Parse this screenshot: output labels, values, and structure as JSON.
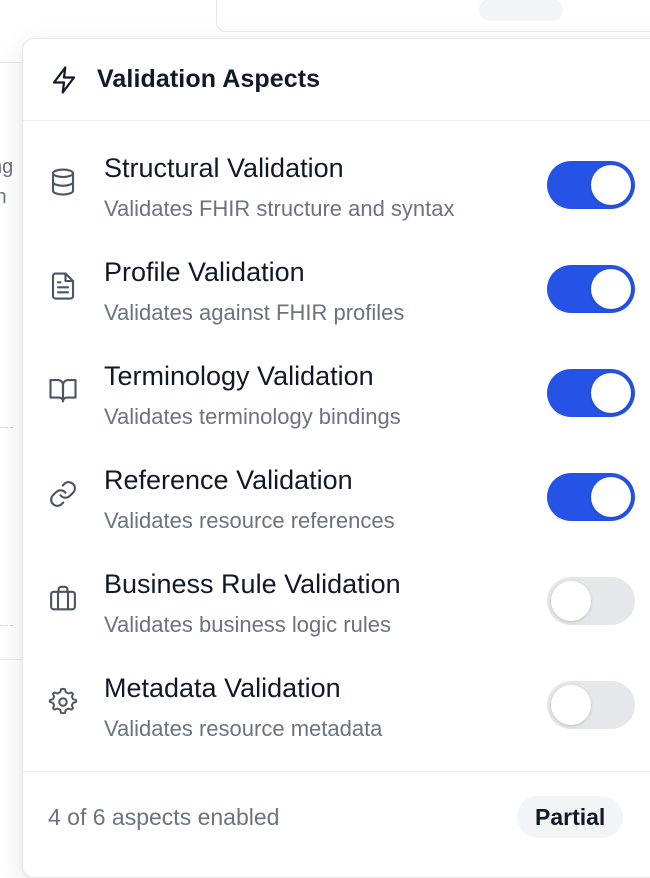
{
  "popover": {
    "title": "Validation Aspects",
    "header_icon": "lightning-icon",
    "aspects": [
      {
        "id": "structural",
        "title": "Structural Validation",
        "description": "Validates FHIR structure and syntax",
        "icon": "database-icon",
        "enabled": true
      },
      {
        "id": "profile",
        "title": "Profile Validation",
        "description": "Validates against FHIR profiles",
        "icon": "document-icon",
        "enabled": true
      },
      {
        "id": "terminology",
        "title": "Terminology Validation",
        "description": "Validates terminology bindings",
        "icon": "book-icon",
        "enabled": true
      },
      {
        "id": "reference",
        "title": "Reference Validation",
        "description": "Validates resource references",
        "icon": "link-icon",
        "enabled": true
      },
      {
        "id": "business",
        "title": "Business Rule Validation",
        "description": "Validates business logic rules",
        "icon": "briefcase-icon",
        "enabled": false
      },
      {
        "id": "metadata",
        "title": "Metadata Validation",
        "description": "Validates resource metadata",
        "icon": "gear-icon",
        "enabled": false
      }
    ],
    "footer": {
      "summary": "4 of 6 aspects enabled",
      "status_badge": "Partial"
    }
  },
  "background": {
    "text_lines": [
      "ng",
      "in"
    ]
  },
  "colors": {
    "toggle_on": "#2453e6",
    "toggle_off": "#e5e7eb",
    "muted_text": "#6b7280"
  }
}
